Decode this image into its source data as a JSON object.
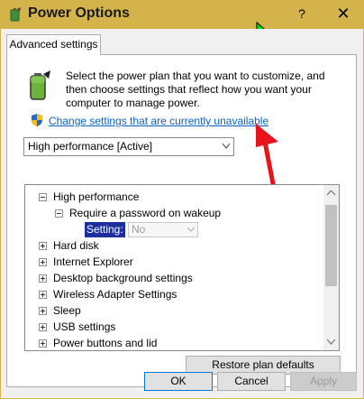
{
  "window": {
    "title": "Power Options",
    "help_label": "?",
    "close_label": "✕"
  },
  "tab": {
    "label": "Advanced settings"
  },
  "description": "Select the power plan that you want to customize, and then choose settings that reflect how you want your computer to manage power.",
  "link": {
    "label": "Change settings that are currently unavailable"
  },
  "plan": {
    "selected": "High performance [Active]"
  },
  "tree": {
    "items": [
      {
        "label": "High performance",
        "state": "expanded"
      },
      {
        "label": "Require a password on wakeup",
        "state": "expanded"
      },
      {
        "setting_label": "Setting:",
        "setting_value": "No"
      },
      {
        "label": "Hard disk",
        "state": "collapsed"
      },
      {
        "label": "Internet Explorer",
        "state": "collapsed"
      },
      {
        "label": "Desktop background settings",
        "state": "collapsed"
      },
      {
        "label": "Wireless Adapter Settings",
        "state": "collapsed"
      },
      {
        "label": "Sleep",
        "state": "collapsed"
      },
      {
        "label": "USB settings",
        "state": "collapsed"
      },
      {
        "label": "Power buttons and lid",
        "state": "collapsed"
      }
    ]
  },
  "buttons": {
    "restore": "Restore plan defaults",
    "ok": "OK",
    "cancel": "Cancel",
    "apply": "Apply"
  },
  "colors": {
    "titlebar": "#d4b44a",
    "link": "#0b63c7",
    "selection": "#1c2ea0",
    "annotation_arrow": "#e8141c"
  }
}
